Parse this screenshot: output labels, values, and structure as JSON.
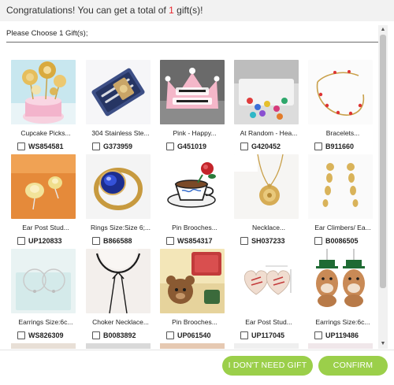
{
  "header": {
    "title_prefix": "Congratulations! You can get a total of ",
    "title_count": "1",
    "title_suffix": " gift(s)!"
  },
  "instruction": "Please Choose 1 Gift(s);",
  "products": [
    {
      "name": "Cupcake Picks...",
      "sku": "WS854581",
      "icon": "cupcake-topper-icon"
    },
    {
      "name": "304 Stainless Ste...",
      "sku": "G373959",
      "icon": "cutlery-set-icon"
    },
    {
      "name": "Pink - Happy...",
      "sku": "G451019",
      "icon": "birthday-crown-icon"
    },
    {
      "name": "At Random - Hea...",
      "sku": "G420452",
      "icon": "pushpins-icon"
    },
    {
      "name": "Bracelets...",
      "sku": "B911660",
      "icon": "bracelet-icon"
    },
    {
      "name": "Ear Post Stud...",
      "sku": "UP120833",
      "icon": "stud-earrings-icon"
    },
    {
      "name": "Rings Size:Size 6;...",
      "sku": "B866588",
      "icon": "ring-icon"
    },
    {
      "name": "Pin Brooches...",
      "sku": "WS854317",
      "icon": "teacup-brooch-icon"
    },
    {
      "name": "Necklace...",
      "sku": "SH037233",
      "icon": "locket-necklace-icon"
    },
    {
      "name": "Ear Climbers/ Ea...",
      "sku": "B0086505",
      "icon": "ear-climber-icon"
    },
    {
      "name": "Earrings Size:6c...",
      "sku": "WS826309",
      "icon": "hoop-earrings-icon"
    },
    {
      "name": "Choker Necklace...",
      "sku": "B0083892",
      "icon": "choker-necklace-icon"
    },
    {
      "name": "Pin Brooches...",
      "sku": "UP061540",
      "icon": "bear-brooch-icon"
    },
    {
      "name": "Ear Post Stud...",
      "sku": "UP117045",
      "icon": "heart-earrings-icon"
    },
    {
      "name": "Earrings Size:6c...",
      "sku": "UP119486",
      "icon": "dog-earrings-icon"
    }
  ],
  "buttons": {
    "decline": "I DON'T NEED GIFT",
    "confirm": "CONFIRM"
  },
  "colors": {
    "accent_green": "#9bcf4a",
    "highlight_red": "#e8242b"
  }
}
